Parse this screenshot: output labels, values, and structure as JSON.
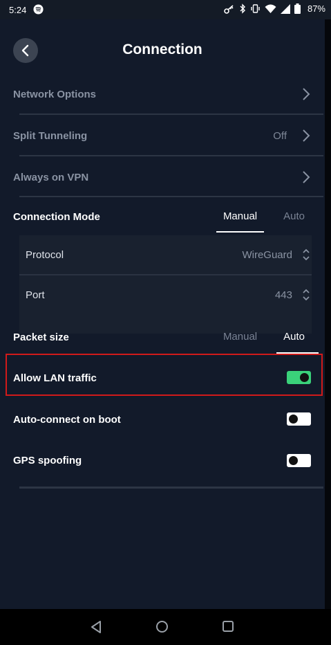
{
  "status_bar": {
    "time": "5:24",
    "battery": "87%"
  },
  "header": {
    "title": "Connection"
  },
  "menu": {
    "network_options": "Network Options",
    "split_tunneling": "Split Tunneling",
    "split_tunneling_value": "Off",
    "always_on_vpn": "Always on VPN"
  },
  "connection_mode": {
    "label": "Connection Mode",
    "tabs": [
      "Manual",
      "Auto"
    ],
    "selected": "Manual"
  },
  "protocol": {
    "label": "Protocol",
    "value": "WireGuard"
  },
  "port": {
    "label": "Port",
    "value": "443"
  },
  "packet_size": {
    "label": "Packet size",
    "tabs": [
      "Manual",
      "Auto"
    ],
    "selected": "Auto"
  },
  "toggles": {
    "allow_lan": {
      "label": "Allow LAN traffic",
      "state": "on"
    },
    "auto_connect": {
      "label": "Auto-connect on boot",
      "state": "off"
    },
    "gps_spoofing": {
      "label": "GPS spoofing",
      "state": "off"
    }
  },
  "colors": {
    "background": "#121a2a",
    "accent_green": "#3ad27a",
    "highlight_red": "#d11a1a"
  }
}
